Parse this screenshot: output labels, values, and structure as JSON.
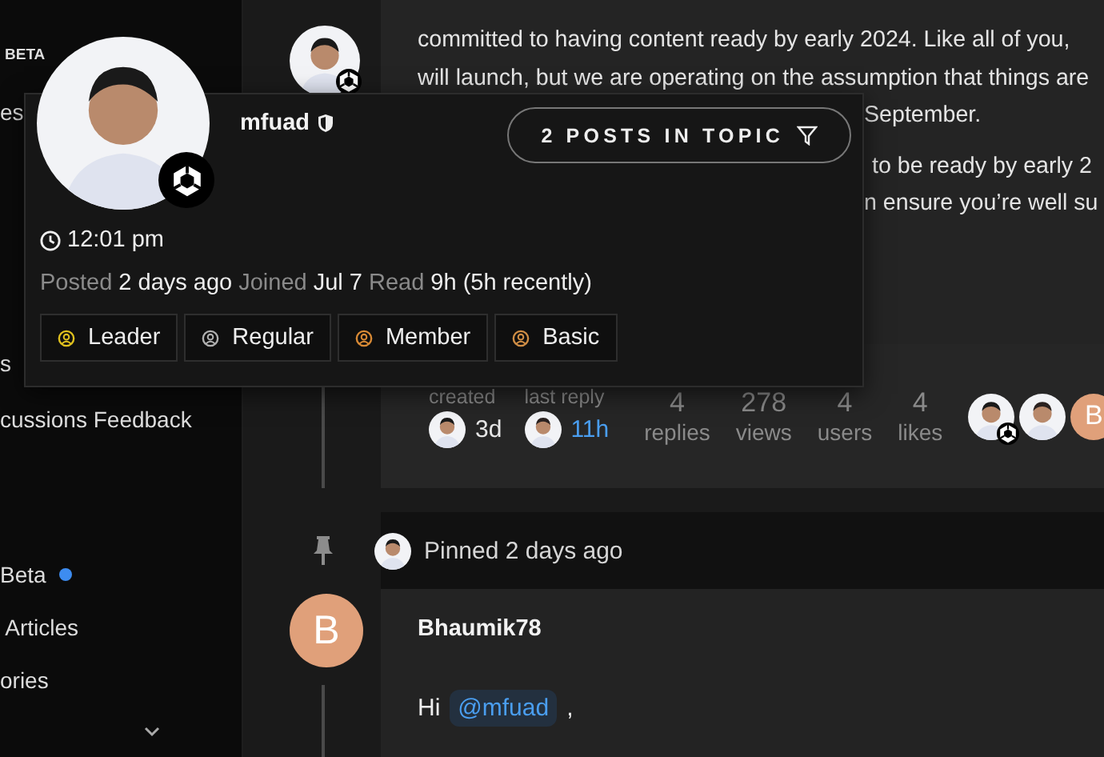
{
  "sidebar": {
    "badge": "BETA",
    "items": [
      {
        "label": "es",
        "unread": false
      },
      {
        "label": "s",
        "unread": false
      },
      {
        "label": "cussions Feedback",
        "unread": false
      },
      {
        "label": "Beta",
        "unread": true
      },
      {
        "label": " Articles",
        "unread": false
      },
      {
        "label": "ories",
        "unread": false
      }
    ]
  },
  "first_post": {
    "lines": [
      {
        "text": "committed to having content ready by early 2024. Like all of you,",
        "kind": "full"
      },
      {
        "text": "will launch, but we are operating on the assumption that things are",
        "kind": "full"
      },
      {
        "text": "September.",
        "kind": "covered"
      },
      {
        "text": "to be ready by early 2",
        "kind": "covered_gap"
      },
      {
        "text": "n ensure you’re well su",
        "kind": "covered"
      }
    ]
  },
  "user_card": {
    "username": "mfuad",
    "posts_button": "2 POSTS IN TOPIC",
    "local_time": "12:01 pm",
    "stats": [
      {
        "label": "Posted",
        "value": "2 days ago"
      },
      {
        "label": "Joined",
        "value": "Jul 7"
      },
      {
        "label": "Read",
        "value": "9h (5h recently)"
      }
    ],
    "groups": [
      {
        "name": "Leader",
        "color": "#e0c11e"
      },
      {
        "name": "Regular",
        "color": "#b0b0b0"
      },
      {
        "name": "Member",
        "color": "#d98a35"
      },
      {
        "name": "Basic",
        "color": "#d08e45"
      }
    ]
  },
  "topic_map": {
    "created": {
      "label": "created",
      "value": "3d"
    },
    "last_reply": {
      "label": "last reply",
      "value": "11h"
    },
    "stats": [
      {
        "value": "4",
        "label": "replies"
      },
      {
        "value": "278",
        "label": "views"
      },
      {
        "value": "4",
        "label": "users"
      },
      {
        "value": "4",
        "label": "likes"
      }
    ],
    "participants": [
      {
        "kind": "photo",
        "staff": true
      },
      {
        "kind": "photo",
        "staff": false
      },
      {
        "kind": "letter",
        "letter": "B"
      }
    ]
  },
  "pinned": {
    "text": "Pinned 2 days ago"
  },
  "reply": {
    "avatar_letter": "B",
    "author": "Bhaumik78",
    "greeting": "Hi",
    "mention": "@mfuad",
    "tail": ","
  }
}
